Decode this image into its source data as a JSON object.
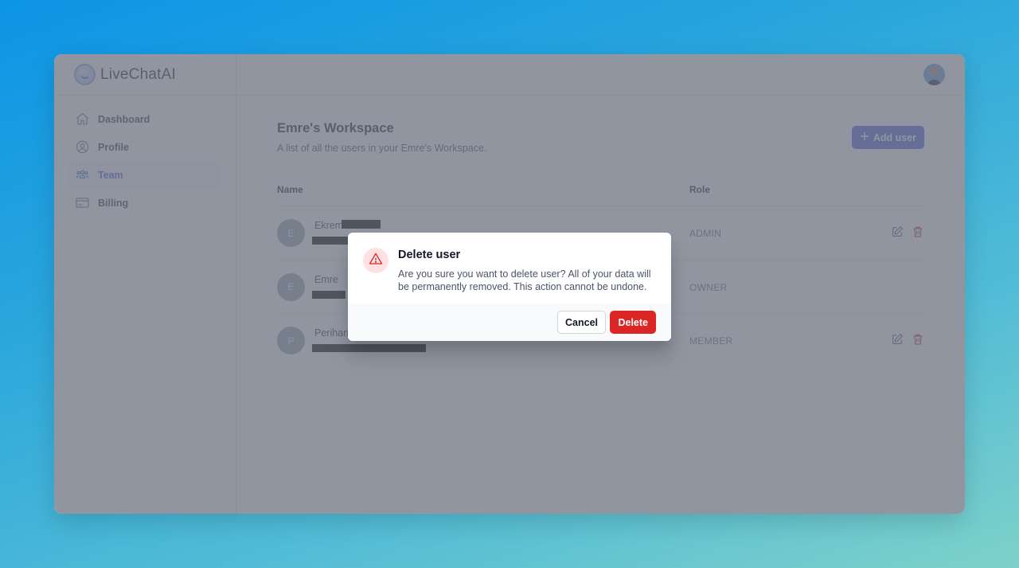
{
  "brand": {
    "name": "LiveChatAI"
  },
  "sidebar": {
    "items": [
      {
        "label": "Dashboard",
        "icon": "home-icon",
        "active": false
      },
      {
        "label": "Profile",
        "icon": "user-circle-icon",
        "active": false
      },
      {
        "label": "Team",
        "icon": "users-group-icon",
        "active": true
      },
      {
        "label": "Billing",
        "icon": "credit-card-icon",
        "active": false
      }
    ]
  },
  "header": {
    "avatar": "user-avatar"
  },
  "workspace": {
    "title": "Emre's Workspace",
    "subtitle": "A list of all the users in your Emre's Workspace.",
    "add_user_label": "Add user"
  },
  "table": {
    "columns": {
      "name": "Name",
      "role": "Role"
    },
    "rows": [
      {
        "initial": "E",
        "name": "Ekrem",
        "role": "ADMIN",
        "editable": true
      },
      {
        "initial": "E",
        "name": "Emre",
        "role": "OWNER",
        "editable": false
      },
      {
        "initial": "P",
        "name": "Perihan",
        "role": "MEMBER",
        "editable": true
      }
    ]
  },
  "modal": {
    "title": "Delete user",
    "message": "Are you sure you want to delete user? All of your data will be permanently removed. This action cannot be undone.",
    "cancel_label": "Cancel",
    "delete_label": "Delete",
    "icon": "warning-triangle-icon"
  },
  "colors": {
    "accent": "#5a5fd6",
    "danger": "#dc2626",
    "danger_soft": "#fee2e2"
  }
}
